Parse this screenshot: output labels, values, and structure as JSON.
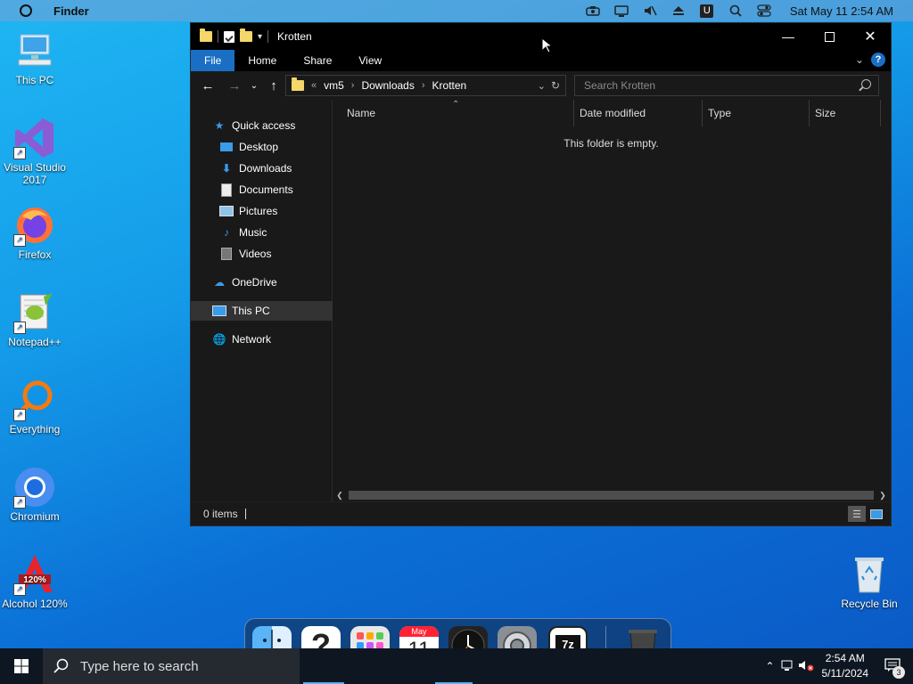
{
  "menubar": {
    "app_name": "Finder",
    "clock": "Sat May 11  2:54 AM",
    "icons": [
      "camera-icon",
      "display-icon",
      "mute-icon",
      "eject-icon",
      "u-badge-icon",
      "search-icon",
      "control-center-icon"
    ]
  },
  "desktop_icons": [
    {
      "label": "This PC"
    },
    {
      "label": "Visual Studio 2017"
    },
    {
      "label": "Firefox"
    },
    {
      "label": "Notepad++"
    },
    {
      "label": "Everything"
    },
    {
      "label": "Chromium"
    },
    {
      "label": "Alcohol 120%"
    },
    {
      "label": "Recycle Bin"
    }
  ],
  "window": {
    "title": "Krotten",
    "ribbon_tabs": [
      "File",
      "Home",
      "Share",
      "View"
    ],
    "address": {
      "overflow": "«",
      "crumbs": [
        "vm5",
        "Downloads",
        "Krotten"
      ]
    },
    "search_placeholder": "Search Krotten",
    "nav": {
      "quick_access": "Quick access",
      "items": [
        "Desktop",
        "Downloads",
        "Documents",
        "Pictures",
        "Music",
        "Videos"
      ],
      "onedrive": "OneDrive",
      "this_pc": "This PC",
      "network": "Network"
    },
    "columns": [
      "Name",
      "Date modified",
      "Type",
      "Size"
    ],
    "empty_message": "This folder is empty.",
    "status": "0 items"
  },
  "dock": {
    "calendar_month": "May",
    "calendar_day": "11"
  },
  "taskbar": {
    "search_placeholder": "Type here to search",
    "time": "2:54 AM",
    "date": "5/11/2024",
    "notification_count": "3"
  },
  "colors": {
    "accent": "#1a6fc4",
    "window_bg": "#191919",
    "titlebar": "#000000"
  }
}
